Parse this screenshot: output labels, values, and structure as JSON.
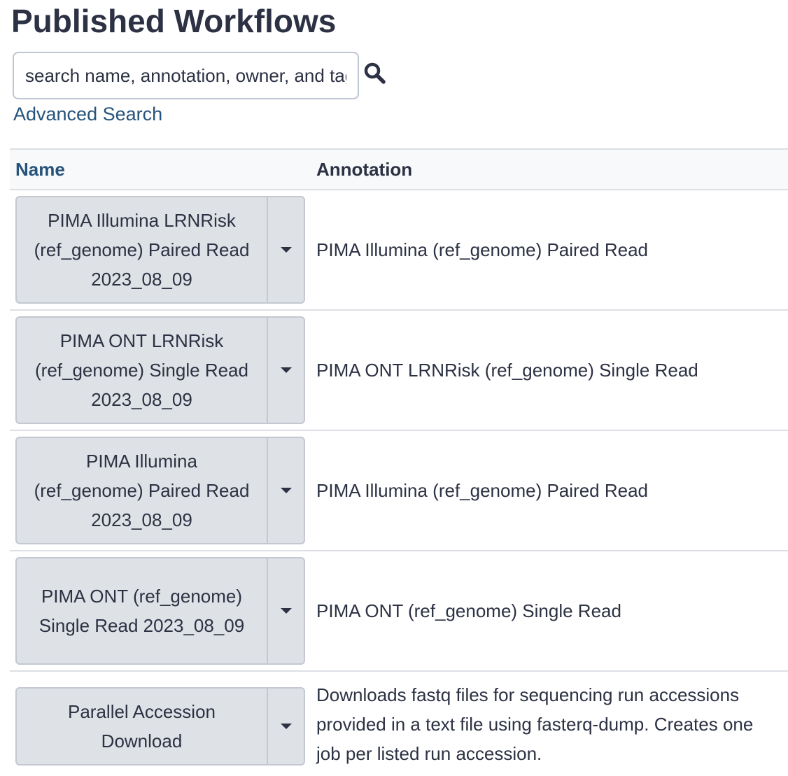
{
  "page": {
    "title": "Published Workflows"
  },
  "search": {
    "placeholder": "search name, annotation, owner, and tags",
    "advanced_label": "Advanced Search"
  },
  "table": {
    "columns": [
      "Name",
      "Annotation"
    ],
    "rows": [
      {
        "name": "PIMA Illumina LRNRisk (ref_genome) Paired Read 2023_08_09",
        "annotation": "PIMA Illumina (ref_genome) Paired Read"
      },
      {
        "name": "PIMA ONT LRNRisk (ref_genome) Single Read 2023_08_09",
        "annotation": "PIMA ONT LRNRisk (ref_genome) Single Read"
      },
      {
        "name": "PIMA Illumina (ref_genome) Paired Read 2023_08_09",
        "annotation": "PIMA Illumina (ref_genome) Paired Read"
      },
      {
        "name": "PIMA ONT (ref_genome) Single Read 2023_08_09",
        "annotation": "PIMA ONT (ref_genome) Single Read"
      },
      {
        "name": "Parallel Accession Download",
        "annotation": "Downloads fastq files for sequencing run accessions provided in a text file using fasterq-dump. Creates one job per listed run accession."
      }
    ]
  },
  "icons": {
    "search": "search-icon",
    "dropdown": "caret-down-icon"
  },
  "colors": {
    "text": "#2c3143",
    "link": "#25537b",
    "button_bg": "#dee2e6",
    "border": "#dcdfe4"
  }
}
